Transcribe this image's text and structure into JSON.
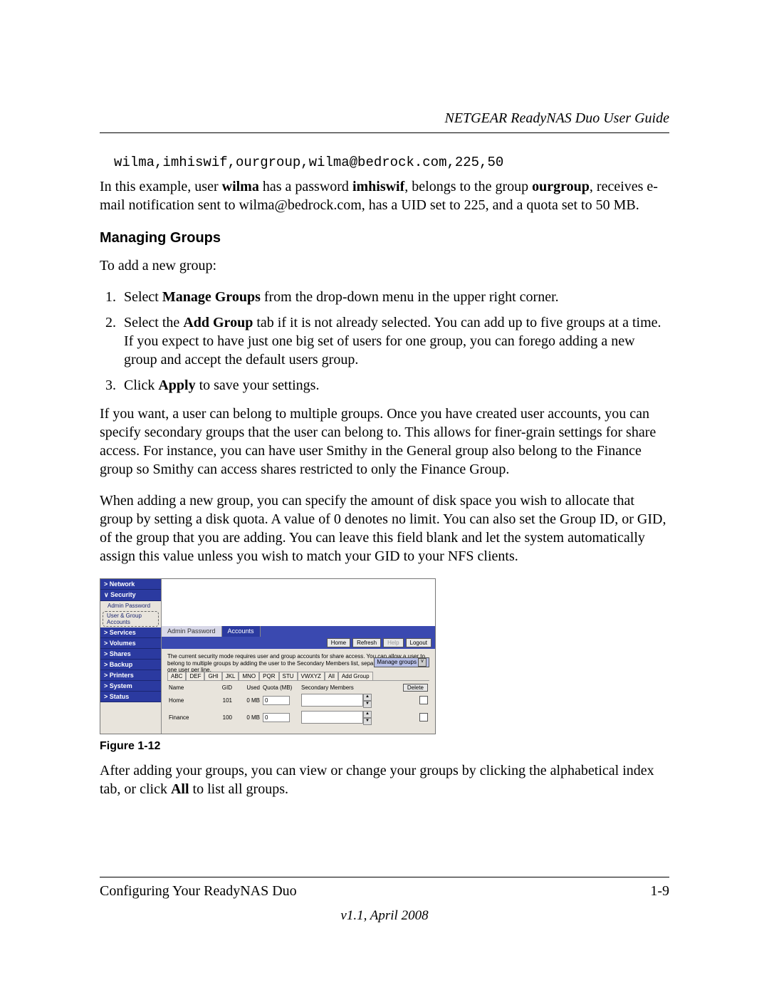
{
  "header": {
    "title": "NETGEAR ReadyNAS Duo User Guide"
  },
  "code_sample": "wilma,imhiswif,ourgroup,wilma@bedrock.com,225,50",
  "example_para": {
    "pre": "In this example, user ",
    "b1": "wilma",
    "mid1": " has a password ",
    "b2": "imhiswif",
    "mid2": ", belongs to the group ",
    "b3": "ourgroup",
    "mid3": ", receives e-mail notification sent to wilma@bedrock.com, has a UID set to 225, and a quota set to 50 MB."
  },
  "section_heading": "Managing Groups",
  "intro": "To add a new group:",
  "steps": {
    "s1": {
      "num": "1.",
      "pre": "Select ",
      "b": "Manage Groups",
      "post": " from the drop-down menu in the upper right corner."
    },
    "s2": {
      "num": "2.",
      "pre": "Select the ",
      "b": "Add Group",
      "post": " tab if it is not already selected. You can add up to five groups at a time. If you expect to have just one big set of users for one group, you can forego adding a new group and accept the default users group."
    },
    "s3": {
      "num": "3.",
      "pre": "Click ",
      "b": "Apply",
      "post": " to save your settings."
    }
  },
  "para4": "If you want, a user can belong to multiple groups. Once you have created user accounts, you can specify secondary groups that the user can belong to. This allows for finer-grain settings for share access. For instance, you can have user Smithy in the General group also belong to the Finance group so Smithy can access shares restricted to only the Finance Group.",
  "para5": "When adding a new group, you can specify the amount of disk space you wish to allocate that group by setting a disk quota. A value of 0 denotes no limit. You can also set the Group ID, or GID, of the group that you are adding. You can leave this field blank and let the system automatically assign this value unless you wish to match your GID to your NFS clients.",
  "screenshot": {
    "nav": {
      "network": "Network",
      "security": "Security",
      "admin_pw": "Admin Password",
      "user_group": "User & Group Accounts",
      "services": "Services",
      "volumes": "Volumes",
      "shares": "Shares",
      "backup": "Backup",
      "printers": "Printers",
      "system": "System",
      "status": "Status"
    },
    "tabs": {
      "admin": "Admin Password",
      "accounts": "Accounts"
    },
    "buttons": {
      "home": "Home",
      "refresh": "Refresh",
      "help": "Help",
      "logout": "Logout"
    },
    "desc": "The current security mode requires user and group accounts for share access. You can allow a user to belong to multiple groups by adding the user to the Secondary Members list, separated by commas or one user per line.",
    "dropdown": "Manage groups",
    "alpha": {
      "a": "ABC",
      "b": "DEF",
      "c": "GHI",
      "d": "JKL",
      "e": "MNO",
      "f": "PQR",
      "g": "STU",
      "h": "VWXYZ",
      "i": "All",
      "j": "Add Group"
    },
    "cols": {
      "name": "Name",
      "gid": "GID",
      "used": "Used",
      "quota": "Quota (MB)",
      "members": "Secondary Members",
      "delete": "Delete"
    },
    "rows": [
      {
        "name": "Home",
        "gid": "101",
        "used": "0 MB",
        "quota": "0"
      },
      {
        "name": "Finance",
        "gid": "100",
        "used": "0 MB",
        "quota": "0"
      }
    ]
  },
  "figure_caption": "Figure 1-12",
  "para_after": {
    "pre": "After adding your groups, you can view or change your groups by clicking the alphabetical index tab, or click ",
    "b": "All",
    "post": " to list all groups."
  },
  "footer": {
    "left": "Configuring Your ReadyNAS Duo",
    "right": "1-9",
    "version": "v1.1, April 2008"
  }
}
